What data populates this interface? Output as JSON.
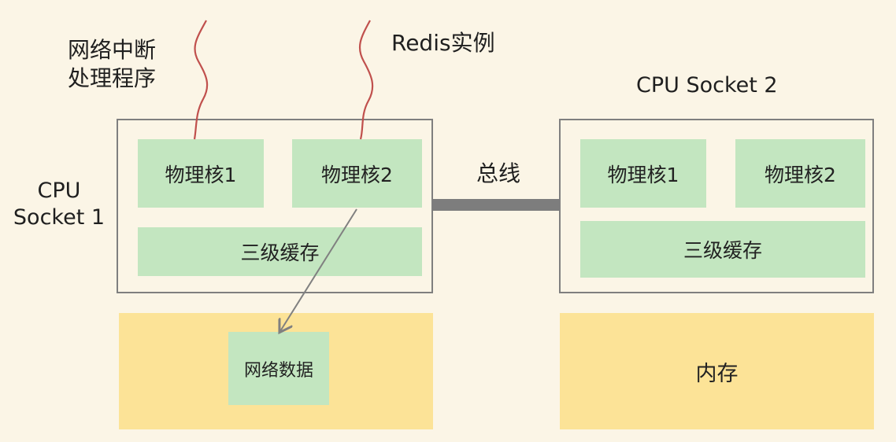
{
  "labels": {
    "interrupt_handler_line1": "网络中断",
    "interrupt_handler_line2": "处理程序",
    "redis_instance": "Redis实例",
    "socket1_line1": "CPU",
    "socket1_line2": "Socket 1",
    "socket2": "CPU Socket 2",
    "bus": "总线"
  },
  "socket1": {
    "core1": "物理核1",
    "core2": "物理核2",
    "l3_cache": "三级缓存",
    "memory_item": "网络数据"
  },
  "socket2": {
    "core1": "物理核1",
    "core2": "物理核2",
    "l3_cache": "三级缓存",
    "memory": "内存"
  },
  "colors": {
    "background": "#fbf5e6",
    "core_fill": "#c3e6c0",
    "memory_fill": "#fce397",
    "socket_border": "#7f7f7f",
    "thread_line": "#c0504d",
    "bus": "#7d7d7d"
  }
}
